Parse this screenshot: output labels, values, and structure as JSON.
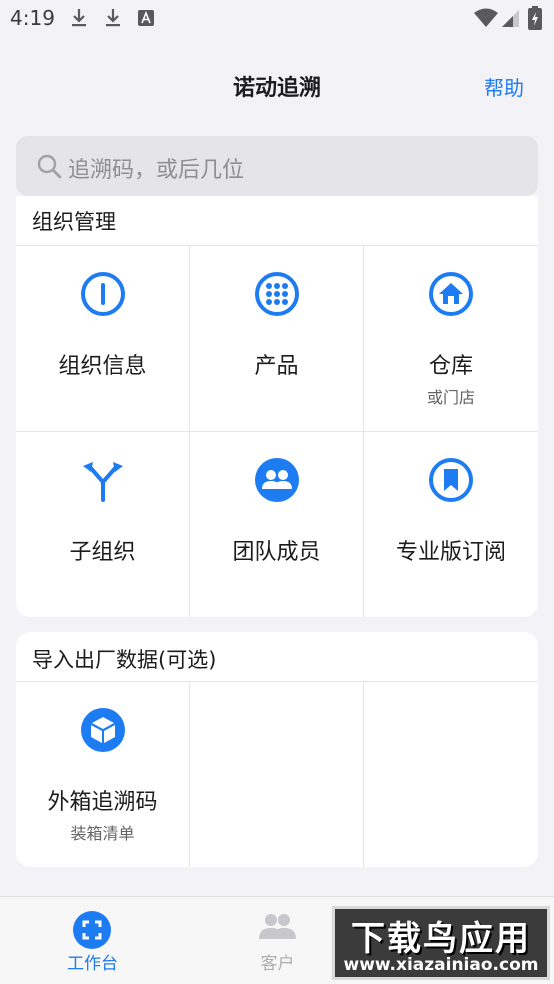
{
  "status_bar": {
    "time": "4:19"
  },
  "nav": {
    "title": "诺动追溯",
    "help": "帮助"
  },
  "search": {
    "placeholder": "追溯码，或后几位"
  },
  "org_section": {
    "title": "组织管理",
    "items": [
      {
        "label": "组织信息",
        "icon": "info-icon"
      },
      {
        "label": "产品",
        "icon": "grid-dots-icon"
      },
      {
        "label": "仓库",
        "sub": "或门店",
        "icon": "house-icon"
      },
      {
        "label": "子组织",
        "icon": "fork-arrows-icon"
      },
      {
        "label": "团队成员",
        "icon": "people-icon"
      },
      {
        "label": "专业版订阅",
        "icon": "bookmark-icon"
      }
    ]
  },
  "import_section": {
    "title": "导入出厂数据(可选)",
    "items": [
      {
        "label": "外箱追溯码",
        "sub": "装箱清单",
        "icon": "box-icon"
      }
    ]
  },
  "tabs": [
    {
      "label": "工作台",
      "active": true,
      "icon": "scan-icon"
    },
    {
      "label": "客户",
      "active": false,
      "icon": "people-icon"
    }
  ],
  "watermark": {
    "main": "下载鸟应用",
    "sub": "www.xiazainiao.com"
  },
  "colors": {
    "accent": "#1E7CF2",
    "background": "#F2F2F7"
  }
}
